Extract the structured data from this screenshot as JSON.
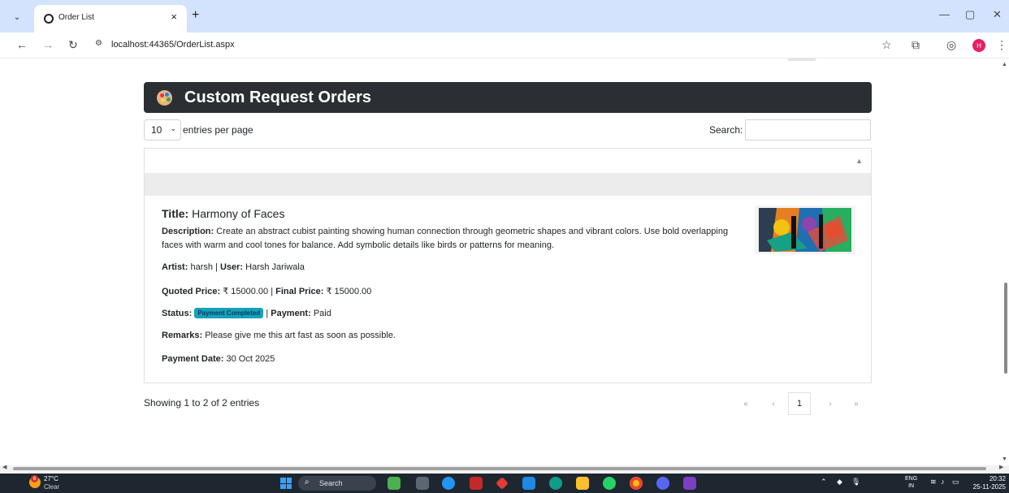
{
  "browser": {
    "tab_title": "Order List",
    "tab_close": "×",
    "new_tab": "+",
    "url": "localhost:44365/OrderList.aspx",
    "profile_initial": "H",
    "window_controls": [
      "—",
      "▢",
      "✕"
    ]
  },
  "page": {
    "card_title": "Custom Request Orders",
    "entries_value": "10",
    "entries_label": "entries per page",
    "search_label": "Search:",
    "order": {
      "title_label": "Title:",
      "title_value": "Harmony of Faces",
      "desc_label": "Description:",
      "desc_value": "Create an abstract cubist painting showing human connection through geometric shapes and vibrant colors. Use bold overlapping faces with warm and cool tones for balance. Add symbolic details like birds or patterns for meaning.",
      "artist_label": "Artist:",
      "artist_value": "harsh",
      "sep": "|",
      "user_label": "User:",
      "user_value": "Harsh Jariwala",
      "quoted_label": "Quoted Price:",
      "quoted_value": "₹ 15000.00",
      "final_label": "Final Price:",
      "final_value": "₹ 15000.00",
      "status_label": "Status:",
      "status_badge": "Payment Completed",
      "payment_label": "Payment:",
      "payment_value": "Paid",
      "remarks_label": "Remarks:",
      "remarks_value": "Please give me this art fast as soon as possible.",
      "payment_date_label": "Payment Date:",
      "payment_date_value": "30 Oct 2025"
    },
    "showing_text": "Showing 1 to 2 of 2 entries",
    "pagination": {
      "first": "«",
      "prev": "‹",
      "current": "1",
      "next": "›",
      "last": "»"
    }
  },
  "taskbar": {
    "weather_temp": "27°C",
    "weather_desc": "Clear",
    "weather_badge": "6",
    "search_placeholder": "Search",
    "lang_line1": "ENG",
    "lang_line2": "IN",
    "time": "20:32",
    "date": "25-11-2025"
  },
  "colors": {
    "header_bg": "#2b2f33",
    "badge_bg": "#17a2b8",
    "tabbar_bg": "#d3e3fd",
    "taskbar_bg": "#1e2630"
  }
}
